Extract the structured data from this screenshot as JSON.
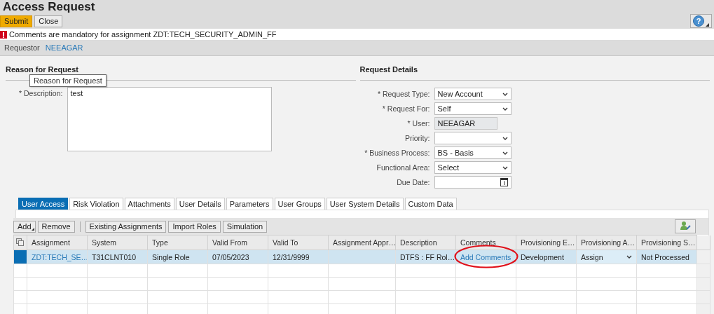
{
  "title": "Access Request",
  "help": {
    "label": "?"
  },
  "actions": [
    {
      "label": "Submit",
      "kind": "primary"
    },
    {
      "label": "Close",
      "kind": "normal"
    }
  ],
  "message": {
    "kind": "error",
    "text": "Comments are mandatory for assignment ZDT:TECH_SECURITY_ADMIN_FF"
  },
  "requestor": {
    "label": "Requestor",
    "value": "NEEAGAR"
  },
  "reason": {
    "heading": "Reason for Request",
    "label": "* Description:",
    "value": "test",
    "tooltip": "Reason for Request"
  },
  "details": {
    "heading": "Request Details",
    "fields": [
      {
        "label": "* Request Type:",
        "value": "New Account",
        "kind": "select"
      },
      {
        "label": "* Request For:",
        "value": "Self",
        "kind": "select"
      },
      {
        "label": "* User:",
        "value": "NEEAGAR",
        "kind": "readonly"
      },
      {
        "label": "Priority:",
        "kind": "select"
      },
      {
        "label": "* Business Process:",
        "value": "BS - Basis",
        "kind": "select"
      },
      {
        "label": "Functional Area:",
        "value": "Select",
        "kind": "select"
      },
      {
        "label": "Due Date:",
        "kind": "date"
      }
    ]
  },
  "tabs": [
    {
      "label": "User Access",
      "selected": true
    },
    {
      "label": "Risk Violation",
      "selected": false
    },
    {
      "label": "Attachments",
      "selected": false
    },
    {
      "label": "User Details",
      "selected": false
    },
    {
      "label": "Parameters",
      "selected": false
    },
    {
      "label": "User Groups",
      "selected": false
    },
    {
      "label": "User System Details",
      "selected": false
    },
    {
      "label": "Custom Data",
      "selected": false
    }
  ],
  "toolbar": [
    {
      "label": "Add",
      "kind": "menu"
    },
    {
      "label": "Remove",
      "kind": "button"
    },
    {
      "kind": "separator"
    },
    {
      "label": "Existing Assignments",
      "kind": "button"
    },
    {
      "label": "Import Roles",
      "kind": "button"
    },
    {
      "label": "Simulation",
      "kind": "button"
    }
  ],
  "table": {
    "columns": [
      "Assignment",
      "System",
      "Type",
      "Valid From",
      "Valid To",
      "Assignment Appr…",
      "Description",
      "Comments",
      "Provisioning E…",
      "Provisioning A…",
      "Provisioning S…"
    ],
    "rows": [
      {
        "selected": true,
        "cells": [
          {
            "text": "ZDT:TECH_SE…",
            "kind": "link"
          },
          {
            "text": "T31CLNT010",
            "kind": "text"
          },
          {
            "text": "Single Role",
            "kind": "text"
          },
          {
            "text": "07/05/2023",
            "kind": "text"
          },
          {
            "text": "12/31/9999",
            "kind": "text"
          },
          {
            "kind": "text"
          },
          {
            "text": "DTFS : FF Rol…",
            "kind": "text"
          },
          {
            "text": "Add Comments",
            "kind": "link"
          },
          {
            "text": "Development",
            "kind": "text"
          },
          {
            "text": "Assign",
            "kind": "select"
          },
          {
            "text": "Not Processed",
            "kind": "text"
          }
        ]
      }
    ]
  },
  "annotation": {
    "kind": "ellipse",
    "color": "#e0101a"
  }
}
